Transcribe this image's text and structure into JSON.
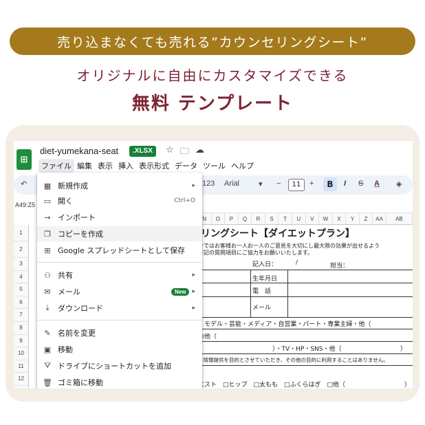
{
  "promo": {
    "banner": "売り込まなくても売れる”カウンセリングシート”",
    "subtitle": "オリジナルに自由にカスタマイズできる",
    "title": "無料 テンプレート"
  },
  "app": {
    "doc_title": "diet-yumekana-seat",
    "file_badge": ".XLSX",
    "menu": [
      "ファイル",
      "編集",
      "表示",
      "挿入",
      "表示形式",
      "データ",
      "ツール",
      "ヘルプ"
    ],
    "active_menu": "ファイル",
    "toolbar": {
      "zoom_partial": "123",
      "font": "Arial",
      "font_size": "11",
      "bold": "B",
      "italic": "I",
      "strike": "S",
      "text_color": "A"
    },
    "cell_ref": "A49:Z5",
    "columns": [
      "N",
      "O",
      "P",
      "Q",
      "R",
      "S",
      "T",
      "U",
      "V",
      "W",
      "X",
      "Y",
      "Z",
      "AA",
      "AB"
    ],
    "rows": [
      "1",
      "2",
      "3",
      "4",
      "5",
      "6",
      "7",
      "8",
      "9",
      "10",
      "11",
      "12",
      "13"
    ],
    "sheet": {
      "title": "リングシート【ダイエットプラン】",
      "intro1": "ンではお客様お一人お一人のご意見を大切にし最大限の効果が出せるよう",
      "intro2": "下記の質問項目にご協力をお願いいたします。",
      "date_label": "記入日：",
      "date_slash": "/",
      "staff_label": "担当：",
      "birth_label": "生年月日",
      "phone_label": "電　話",
      "mail_label": "メール",
      "occupation": "・モデル・芸能・メディア・自営業・パート・専業主婦・他（",
      "other": "の他（",
      "source": "）・TV・HP・SNS・他（",
      "source_end": "）",
      "privacy": "る情報提供を目的とさせていただき、その他の目的に利用することはありません。",
      "body_parts": "エスト　□ヒップ　□太もも　□ふくらはぎ　□他（",
      "body_parts_end": "）"
    },
    "file_menu": [
      {
        "icon": "new-sheet-icon",
        "label": "新規作成",
        "shortcut": "",
        "arrow": "▸"
      },
      {
        "icon": "folder-icon",
        "label": "開く",
        "shortcut": "Ctrl+O",
        "arrow": ""
      },
      {
        "icon": "import-icon",
        "label": "インポート",
        "shortcut": "",
        "arrow": ""
      },
      {
        "icon": "copy-icon",
        "label": "コピーを作成",
        "shortcut": "",
        "arrow": ""
      },
      {
        "icon": "save-icon",
        "label": "Google スプレッドシートとして保存",
        "shortcut": "",
        "arrow": ""
      },
      {
        "icon": "share-icon",
        "label": "共有",
        "shortcut": "",
        "arrow": "▸"
      },
      {
        "icon": "mail-icon",
        "label": "メール",
        "shortcut": "",
        "arrow": "▸",
        "badge": "New"
      },
      {
        "icon": "download-icon",
        "label": "ダウンロード",
        "shortcut": "",
        "arrow": "▸"
      },
      {
        "icon": "rename-icon",
        "label": "名前を変更",
        "shortcut": "",
        "arrow": ""
      },
      {
        "icon": "move-icon",
        "label": "移動",
        "shortcut": "",
        "arrow": ""
      },
      {
        "icon": "drive-shortcut-icon",
        "label": "ドライブにショートカットを追加",
        "shortcut": "",
        "arrow": ""
      },
      {
        "icon": "trash-icon",
        "label": "ゴミ箱に移動",
        "shortcut": "",
        "arrow": ""
      }
    ]
  },
  "colors": {
    "banner": "#a57a1c",
    "accent": "#7d2232",
    "card": "#f3ede3",
    "sheets_green": "#1e8e3e"
  }
}
